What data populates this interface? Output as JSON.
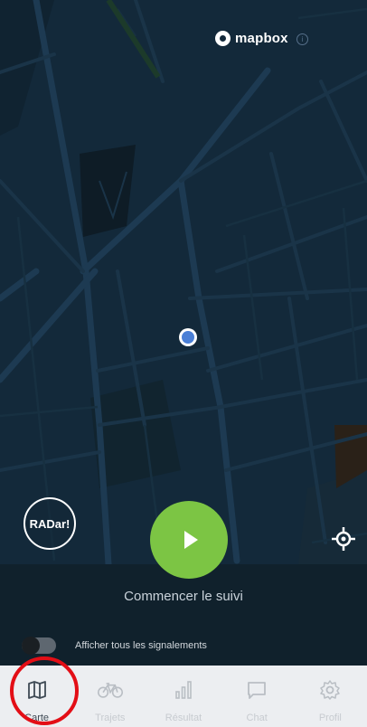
{
  "map": {
    "attribution_logo": "mapbox",
    "info_icon": "info-icon"
  },
  "controls": {
    "radar_label": "RADar!",
    "play_icon": "play-icon",
    "locate_icon": "crosshair-icon",
    "start_label": "Commencer le suivi"
  },
  "filter": {
    "toggle_state": "off",
    "label": "Afficher tous les signalements"
  },
  "tabbar": {
    "tabs": [
      {
        "label": "Carte",
        "icon": "map-icon",
        "active": true
      },
      {
        "label": "Trajets",
        "icon": "bicycle-icon",
        "active": false
      },
      {
        "label": "Résultat",
        "icon": "bar-chart-icon",
        "active": false
      },
      {
        "label": "Chat",
        "icon": "chat-bubble-icon",
        "active": false
      },
      {
        "label": "Profil",
        "icon": "gear-icon",
        "active": false
      }
    ]
  },
  "colors": {
    "play_button": "#7cc544",
    "map_background": "#13293a",
    "highlight": "#e30e16",
    "location_dot": "#4a7fd6"
  }
}
